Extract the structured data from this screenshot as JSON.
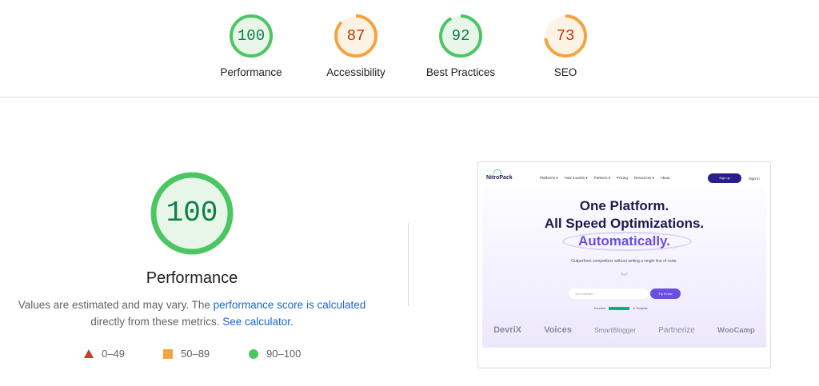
{
  "gauges": [
    {
      "score": "100",
      "label": "Performance",
      "color": "#0b8043",
      "ring": "#4cc663",
      "fill": "#e8f6ea",
      "value": 100
    },
    {
      "score": "87",
      "label": "Accessibility",
      "color": "#c33300",
      "ring": "#f4a340",
      "fill": "#fdf3e5",
      "value": 87
    },
    {
      "score": "92",
      "label": "Best Practices",
      "color": "#0b8043",
      "ring": "#4cc663",
      "fill": "#e8f6ea",
      "value": 92
    },
    {
      "score": "73",
      "label": "SEO",
      "color": "#c33300",
      "ring": "#f4a340",
      "fill": "#fdf3e5",
      "value": 73
    }
  ],
  "performance": {
    "score": "100",
    "title": "Performance",
    "desc_prefix": "Values are estimated and may vary. The ",
    "desc_link1": "performance score is calculated",
    "desc_middle": " directly from these metrics. ",
    "desc_link2": "See calculator.",
    "ring_color": "#4cc663",
    "fill_color": "#e8f6ea"
  },
  "legend": {
    "fail": "0–49",
    "average": "50–89",
    "pass": "90–100"
  },
  "screenshot": {
    "logo": "NitroPack",
    "menu": [
      "Platforms ▾",
      "How it works ▾",
      "Partners ▾",
      "Pricing",
      "Resources ▾",
      "About"
    ],
    "signup": "Sign up",
    "signin": "Sign in",
    "headline1": "One Platform.",
    "headline2": "All Speed Optimizations.",
    "headline3": "Automatically.",
    "subtitle": "Outperform competitors without writing a single line of code.",
    "chevron": "︾",
    "input_placeholder": "Your website",
    "button": "Try it now",
    "trust_label": "Excellent",
    "trust_brand": "★ Trustpilot",
    "brands": [
      "DevriX",
      "Voices",
      "SmartBlogger",
      "Partnerize",
      "WooCamp"
    ]
  }
}
